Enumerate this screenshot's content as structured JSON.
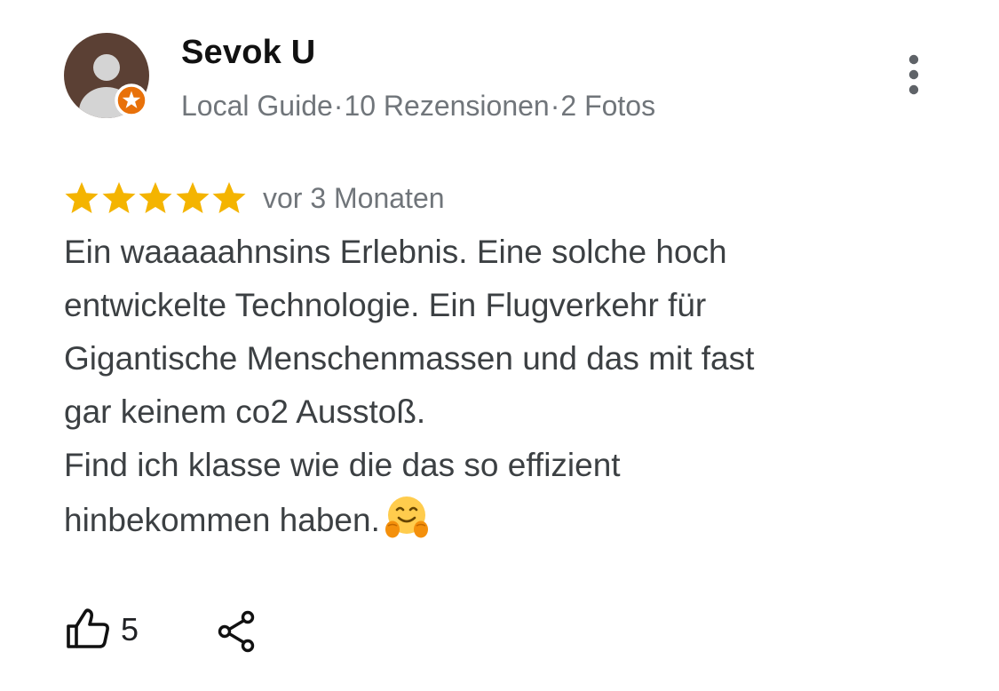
{
  "author": {
    "name": "Sevok U",
    "badge": "Local Guide",
    "separator": "·",
    "reviews": "10 Rezensionen",
    "photos": "2 Fotos",
    "avatar_icon": "person-placeholder-icon",
    "badge_icon": "local-guide-star-icon"
  },
  "review": {
    "rating": 5,
    "rating_max": 5,
    "date": "vor 3 Monaten",
    "text": "Ein waaaaahnsins Erlebnis. Eine solche hoch\nentwickelte Technologie. Ein Flugverkehr für\nGigantische Menschenmassen und das mit fast\ngar keinem co2 Ausstoß.\nFind ich klasse wie die das so effizient\nhinbekommen haben.",
    "emoji_icon": "hugging-face-emoji"
  },
  "actions": {
    "like_count": "5",
    "like_icon": "thumbs-up-icon",
    "share_icon": "share-icon",
    "more_icon": "more-vert-icon"
  },
  "colors": {
    "star": "#f4b400",
    "badge": "#e8710a",
    "meta_text": "#70757a",
    "body_text": "#3c4043",
    "avatar_bg": "#5b4034"
  }
}
